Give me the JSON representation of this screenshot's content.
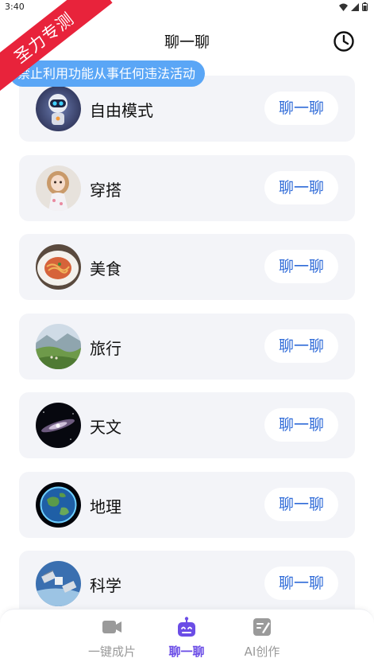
{
  "status": {
    "time": "3:40"
  },
  "header": {
    "title": "聊一聊"
  },
  "ribbon": {
    "text": "圣力专测"
  },
  "notice": {
    "text": "禁止利用功能从事任何违法活动"
  },
  "topics": [
    {
      "label": "自由模式",
      "button": "聊一聊",
      "avatar": "robot-avatar"
    },
    {
      "label": "穿搭",
      "button": "聊一聊",
      "avatar": "doll-avatar"
    },
    {
      "label": "美食",
      "button": "聊一聊",
      "avatar": "pasta-avatar"
    },
    {
      "label": "旅行",
      "button": "聊一聊",
      "avatar": "landscape-avatar"
    },
    {
      "label": "天文",
      "button": "聊一聊",
      "avatar": "galaxy-avatar"
    },
    {
      "label": "地理",
      "button": "聊一聊",
      "avatar": "earth-avatar"
    },
    {
      "label": "科学",
      "button": "聊一聊",
      "avatar": "satellite-avatar"
    }
  ],
  "tabs": [
    {
      "label": "一键成片",
      "icon": "video-icon",
      "active": false
    },
    {
      "label": "聊一聊",
      "icon": "robot-icon",
      "active": true
    },
    {
      "label": "AI创作",
      "icon": "edit-icon",
      "active": false
    }
  ],
  "colors": {
    "accent": "#6b4de6",
    "button_text": "#2f6bd8",
    "notice_bg": "#5aa6f6",
    "ribbon_bg": "#e8233b",
    "card_bg": "#f3f4f8"
  }
}
